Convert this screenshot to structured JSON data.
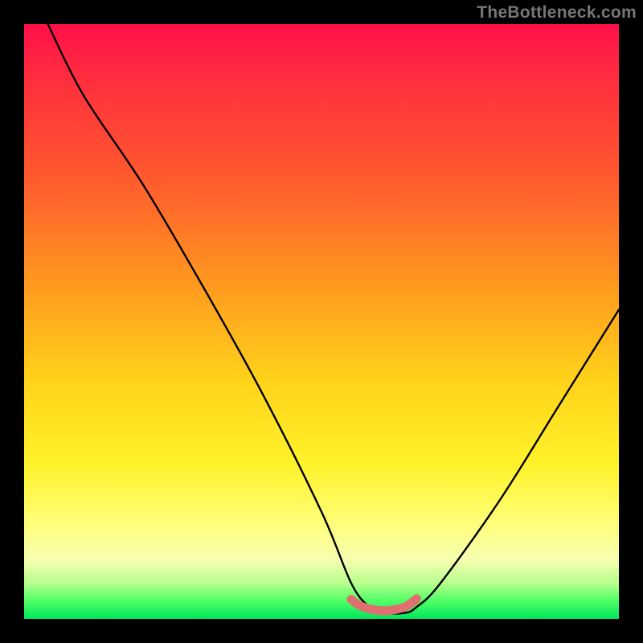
{
  "watermark": "TheBottleneck.com",
  "chart_data": {
    "type": "line",
    "title": "",
    "xlabel": "",
    "ylabel": "",
    "xlim": [
      0,
      100
    ],
    "ylim": [
      0,
      100
    ],
    "series": [
      {
        "name": "bottleneck-curve",
        "x": [
          4,
          10,
          20,
          30,
          40,
          50,
          55,
          58,
          60,
          64,
          66,
          70,
          80,
          90,
          100
        ],
        "values": [
          100,
          88,
          73,
          56,
          38,
          18,
          6,
          2,
          1,
          1,
          2,
          6,
          20,
          36,
          52
        ]
      }
    ],
    "highlight": {
      "name": "optimal-range",
      "x": [
        55,
        56,
        57,
        58,
        59,
        60,
        61,
        62,
        63,
        64,
        65,
        66
      ],
      "values": [
        3.3,
        2.5,
        2.0,
        1.7,
        1.5,
        1.4,
        1.4,
        1.5,
        1.7,
        2.0,
        2.6,
        3.4
      ]
    },
    "gradient_stops": [
      {
        "pos": 0,
        "color": "#ff1049"
      },
      {
        "pos": 8,
        "color": "#ff2a3f"
      },
      {
        "pos": 26,
        "color": "#ff5a2e"
      },
      {
        "pos": 44,
        "color": "#ff9a1f"
      },
      {
        "pos": 60,
        "color": "#ffd31a"
      },
      {
        "pos": 74,
        "color": "#fff22a"
      },
      {
        "pos": 84,
        "color": "#ffff7a"
      },
      {
        "pos": 90,
        "color": "#f7ffb0"
      },
      {
        "pos": 94,
        "color": "#b8ff8e"
      },
      {
        "pos": 97,
        "color": "#4fff66"
      },
      {
        "pos": 100,
        "color": "#00e65c"
      }
    ]
  }
}
